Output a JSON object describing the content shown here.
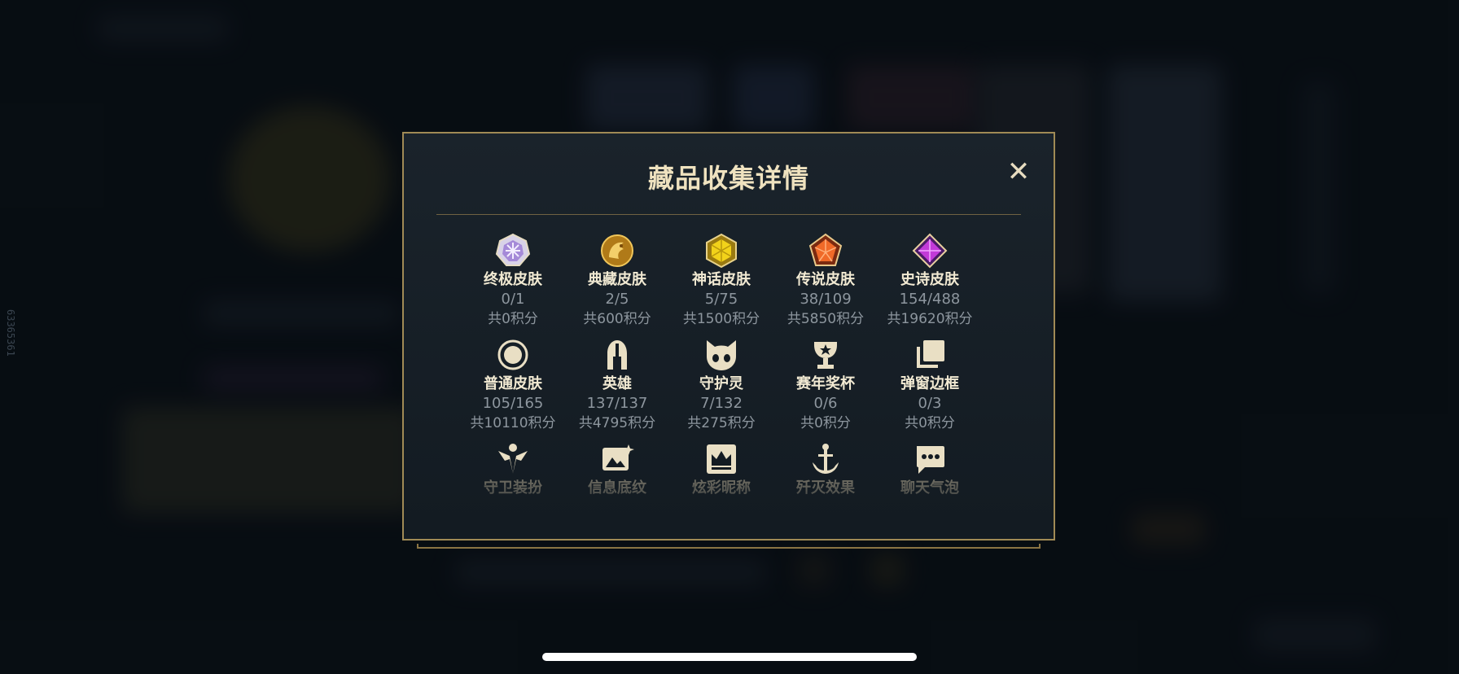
{
  "side_id": "63365361",
  "modal": {
    "title": "藏品收集详情",
    "close_glyph": "✕"
  },
  "rows": [
    [
      {
        "icon": "ultimate-skin-icon",
        "name": "终极皮肤",
        "count": "0/1",
        "points": "共0积分"
      },
      {
        "icon": "collector-skin-icon",
        "name": "典藏皮肤",
        "count": "2/5",
        "points": "共600积分"
      },
      {
        "icon": "mythic-skin-icon",
        "name": "神话皮肤",
        "count": "5/75",
        "points": "共1500积分"
      },
      {
        "icon": "legendary-skin-icon",
        "name": "传说皮肤",
        "count": "38/109",
        "points": "共5850积分"
      },
      {
        "icon": "epic-skin-icon",
        "name": "史诗皮肤",
        "count": "154/488",
        "points": "共19620积分"
      }
    ],
    [
      {
        "icon": "standard-skin-icon",
        "name": "普通皮肤",
        "count": "105/165",
        "points": "共10110积分"
      },
      {
        "icon": "helmet-icon",
        "name": "英雄",
        "count": "137/137",
        "points": "共4795积分"
      },
      {
        "icon": "guardian-icon",
        "name": "守护灵",
        "count": "7/132",
        "points": "共275积分"
      },
      {
        "icon": "trophy-icon",
        "name": "赛年奖杯",
        "count": "0/6",
        "points": "共0积分"
      },
      {
        "icon": "frames-icon",
        "name": "弹窗边框",
        "count": "0/3",
        "points": "共0积分"
      }
    ],
    [
      {
        "icon": "ward-icon",
        "name": "守卫装扮"
      },
      {
        "icon": "banner-icon",
        "name": "信息底纹"
      },
      {
        "icon": "crown-icon",
        "name": "炫彩昵称"
      },
      {
        "icon": "anchor-icon",
        "name": "歼灭效果"
      },
      {
        "icon": "chat-bubble-icon",
        "name": "聊天气泡"
      }
    ]
  ],
  "colors": {
    "gold_border": "#a08a55",
    "title": "#efe2bf",
    "label": "#f2ead3",
    "muted": "#8d969e"
  }
}
